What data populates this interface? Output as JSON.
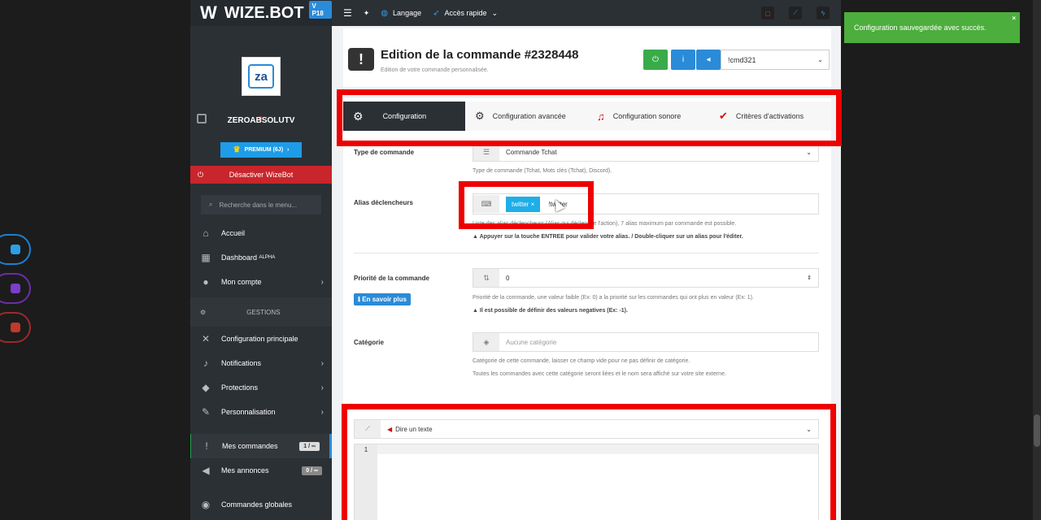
{
  "brand": {
    "logo": "W",
    "name": "WIZE.BOT",
    "version": "V P18"
  },
  "profile": {
    "avatar_text": "za",
    "username": "ZEROABSOLUTV"
  },
  "premium": {
    "label": "PREMIUM (6J)"
  },
  "disable": {
    "label": "Désactiver WizeBot"
  },
  "search": {
    "placeholder": "Recherche dans le menu..."
  },
  "nav": {
    "accueil": "Accueil",
    "dashboard": "Dashboard",
    "dashboard_sup": "ALPHA",
    "compte": "Mon compte",
    "section_gestions": "GESTIONS",
    "config_principale": "Configuration principale",
    "notifications": "Notifications",
    "protections": "Protections",
    "personnalisation": "Personnalisation",
    "mes_commandes": "Mes commandes",
    "mes_commandes_badge": "1 / ∞",
    "mes_annonces": "Mes annonces",
    "mes_annonces_badge": "0 / ∞",
    "commandes_globales": "Commandes globales"
  },
  "topbar": {
    "langage": "Langage",
    "acces_rapide": "Accès rapide"
  },
  "header": {
    "title": "Edition de la commande #2328448",
    "subtitle": "Edition de votre commande personnalisée.",
    "command_select": "!cmd321"
  },
  "tabs": {
    "config": "Configuration",
    "config_avancee": "Configuration avancée",
    "config_sonore": "Configuration sonore",
    "criteres": "Critères d'activations"
  },
  "form": {
    "type_label": "Type de commande",
    "type_value": "Commande Tchat",
    "type_help": "Type de commande (Tchat, Mots clés (Tchat), Discord).",
    "alias_label": "Alias déclencheurs",
    "alias_tag": "twitter",
    "alias_input": "!twitter",
    "alias_help": "Liste des alias déclencheurs (Alias qui déclenche l'action), 7 alias maximum par commande est possible.",
    "alias_warn": "Appuyer sur la touche ENTREE pour valider votre alias. / Double-cliquer sur un alias pour l'éditer.",
    "priorite_label": "Priorité de la commande",
    "priorite_value": "0",
    "info_btn": "En savoir plus",
    "priorite_help": "Priorité de la commande, une valeur faible (Ex: 0) a la priorité sur les commandes qui ont plus en valeur (Ex: 1).",
    "priorite_warn": "Il est possible de définir des valeurs negatives (Ex: -1).",
    "categorie_label": "Catégorie",
    "categorie_placeholder": "Aucune catégorie",
    "categorie_help1": "Catégorie de cette commande, laisser ce champ vide pour ne pas définir de catégorie.",
    "categorie_help2": "Toutes les commandes avec cette catégorie seront liées et le nom sera affiché sur votre site externe."
  },
  "action": {
    "select_value": "Dire un texte",
    "line_number": "1"
  },
  "toast": {
    "message": "Configuration sauvegardée avec succès.",
    "close": "×"
  },
  "colors": {
    "accent": "#2a8bd8",
    "danger": "#c9252c",
    "success": "#4cae3c",
    "highlight": "#ee0000"
  }
}
